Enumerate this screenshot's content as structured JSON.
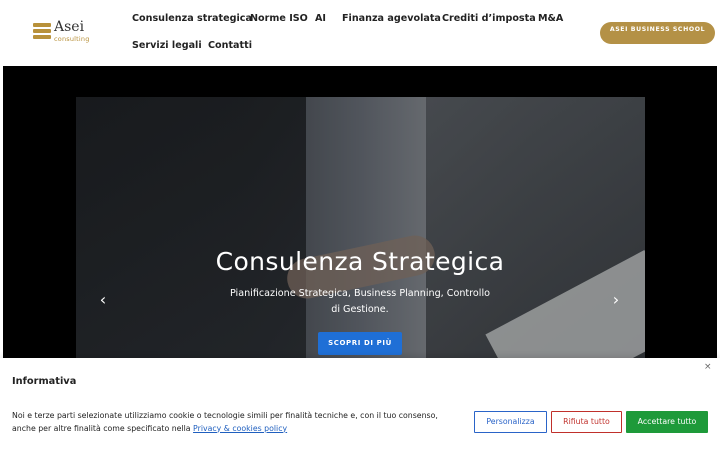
{
  "header": {
    "logo": {
      "name": "Asei",
      "tagline": "consulting"
    },
    "nav": [
      {
        "label": "Consulenza strategica"
      },
      {
        "label": "Norme ISO"
      },
      {
        "label": "AI"
      },
      {
        "label": "Finanza agevolata"
      },
      {
        "label": "Crediti d’imposta"
      },
      {
        "label": "M&A"
      },
      {
        "label": "Servizi legali"
      },
      {
        "label": "Contatti"
      }
    ],
    "cta_label": "ASEI BUSINESS SCHOOL"
  },
  "hero": {
    "title": "Consulenza Strategica",
    "subtitle": "Pianificazione Strategica, Business Planning, Controllo di Gestione.",
    "button_label": "SCOPRI DI PIÙ",
    "prev_icon": "‹",
    "next_icon": "›"
  },
  "cookie": {
    "title": "Informativa",
    "close_icon": "×",
    "text": "Noi e terze parti selezionate utilizziamo cookie o tecnologie simili per finalità tecniche e, con il tuo consenso, anche per altre finalità come specificato nella ",
    "link_label": "Privacy & cookies policy",
    "buttons": {
      "customize": "Personalizza",
      "reject": "Rifiuta tutto",
      "accept": "Accettare tutto"
    }
  },
  "colors": {
    "brand_gold": "#b49146",
    "primary_blue": "#1f6fd6",
    "reject_red": "#c0302b",
    "accept_green": "#1e9a3a"
  }
}
